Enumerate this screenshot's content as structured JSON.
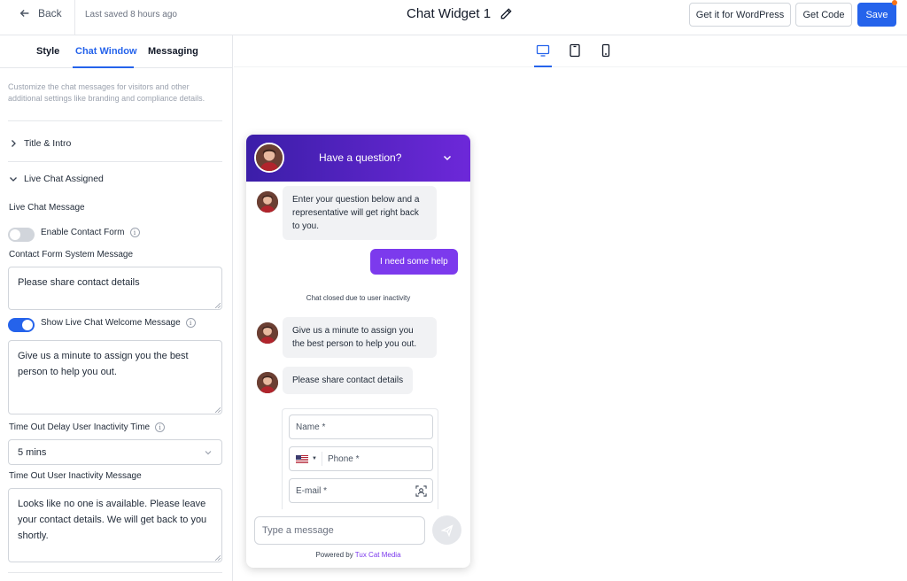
{
  "topbar": {
    "back_label": "Back",
    "saved_status": "Last saved 8 hours ago",
    "widget_title": "Chat Widget 1",
    "buttons": {
      "wordpress": "Get it for WordPress",
      "get_code": "Get Code",
      "save": "Save"
    }
  },
  "sidebar": {
    "tabs": [
      "Style",
      "Chat Window",
      "Messaging"
    ],
    "active_tab": "Chat Window",
    "description": "Customize the chat messages for visitors and other additional settings like branding and compliance details.",
    "sections": {
      "title_intro": "Title & Intro",
      "live_chat_assigned": "Live Chat Assigned"
    },
    "live_chat_message_label": "Live Chat Message",
    "enable_contact_form": {
      "label": "Enable Contact Form",
      "enabled": false
    },
    "contact_form_system_message": {
      "label": "Contact Form System Message",
      "value": "Please share contact details"
    },
    "show_welcome_message": {
      "label": "Show Live Chat Welcome Message",
      "enabled": true
    },
    "welcome_message_value": "Give us a minute to assign you the best person to help you out.",
    "timeout_delay": {
      "label": "Time Out Delay User Inactivity Time",
      "value": "5 mins"
    },
    "timeout_message": {
      "label": "Time Out User Inactivity Message",
      "value": "Looks like no one is available. Please leave your contact details. We will get back to you shortly."
    }
  },
  "preview": {
    "devices": [
      "desktop-icon",
      "tablet-icon",
      "mobile-icon"
    ],
    "active_device": "desktop",
    "widget": {
      "header_title": "Have a question?",
      "messages": {
        "agent_1": "Enter your question below and a representative will get right back to you.",
        "user_1": "I need some help",
        "system_1": "Chat closed due to user inactivity",
        "agent_2": "Give us a minute to assign you the best person to help you out.",
        "agent_3": "Please share contact details"
      },
      "form": {
        "name_placeholder": "Name *",
        "phone_placeholder": "Phone *",
        "email_placeholder": "E-mail *"
      },
      "input_placeholder": "Type a message",
      "powered_by_prefix": "Powered by",
      "powered_by_brand": "Tux Cat Media"
    }
  },
  "colors": {
    "accent": "#2563eb",
    "widget_purple": "#6d28d9",
    "user_bubble": "#7c3aed"
  }
}
